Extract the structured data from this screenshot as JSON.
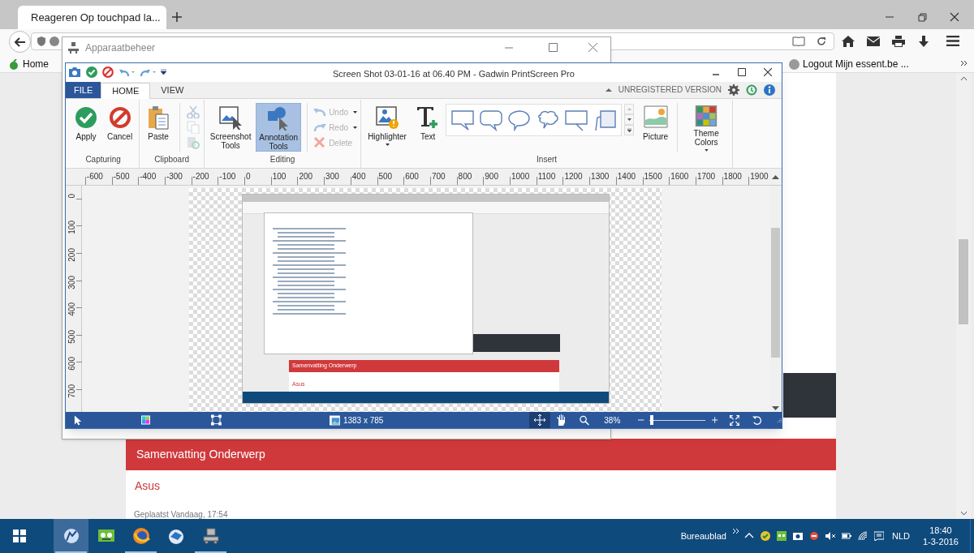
{
  "browser": {
    "tab": {
      "title": "Reageren Op touchpad la..."
    },
    "bookmarks": [
      {
        "label": "Home"
      },
      {
        "label": "Logout Mijn essent.be ..."
      }
    ],
    "page": {
      "card_title": "Samenvatting Onderwerp",
      "card_subtitle": "Asus",
      "posted": "Geplaatst Vandaag, 17:54"
    }
  },
  "device_manager": {
    "title": "Apparaatbeheer"
  },
  "editor": {
    "title": "Screen Shot 03-01-16 at 06.40 PM - Gadwin PrintScreen Pro",
    "ribbon_tabs": [
      {
        "label": "FILE",
        "kind": "file",
        "selected": false
      },
      {
        "label": "HOME",
        "kind": "tab",
        "selected": true
      },
      {
        "label": "VIEW",
        "kind": "tab",
        "selected": false
      }
    ],
    "registration": "UNREGISTERED VERSION",
    "groups": [
      {
        "label": "Capturing",
        "items": [
          {
            "kind": "large",
            "label": "Apply",
            "selected": false,
            "dropdown": false
          },
          {
            "kind": "large",
            "label": "Cancel",
            "selected": false,
            "dropdown": false
          }
        ]
      },
      {
        "label": "Clipboard",
        "items": [
          {
            "kind": "large",
            "label": "Paste",
            "selected": false,
            "dropdown": false
          },
          {
            "kind": "separator"
          },
          {
            "kind": "icon",
            "disabled": true
          },
          {
            "kind": "icon",
            "disabled": true
          },
          {
            "kind": "icon",
            "disabled": true
          }
        ]
      },
      {
        "label": "Editing",
        "items": [
          {
            "kind": "large",
            "label": "Screenshot Tools",
            "selected": false,
            "dropdown": false
          },
          {
            "kind": "large",
            "label": "Annotation Tools",
            "selected": true,
            "dropdown": false
          },
          {
            "kind": "separator"
          },
          {
            "kind": "small",
            "label": "Undo",
            "disabled": true,
            "dropdown": true
          },
          {
            "kind": "small",
            "label": "Redo",
            "disabled": true,
            "dropdown": true
          },
          {
            "kind": "small",
            "label": "Delete",
            "disabled": true,
            "dropdown": false
          }
        ]
      },
      {
        "label": "Insert",
        "items": [
          {
            "kind": "large",
            "label": "Highlighter",
            "selected": false,
            "dropdown": true
          },
          {
            "kind": "large",
            "label": "Text",
            "selected": false,
            "dropdown": false
          },
          {
            "kind": "gallery"
          },
          {
            "kind": "large",
            "label": "Picture",
            "selected": false,
            "dropdown": false
          },
          {
            "kind": "separator"
          },
          {
            "kind": "large",
            "label": "Theme Colors",
            "selected": false,
            "dropdown": true
          }
        ]
      }
    ],
    "ruler": {
      "horizontal": [
        "-600",
        "-500",
        "-400",
        "-300",
        "-200",
        "-100",
        "0",
        "100",
        "200",
        "300",
        "400",
        "500",
        "600",
        "700",
        "800",
        "900",
        "1000",
        "1100",
        "1200",
        "1300",
        "1400",
        "1500",
        "1600",
        "1700",
        "1800",
        "1900"
      ],
      "vertical": [
        "0",
        "100",
        "200",
        "300",
        "400",
        "500",
        "600",
        "700"
      ]
    },
    "preview": {
      "card_title": "Samenvatting Onderwerp",
      "card_subtitle": "Asus"
    },
    "status": {
      "dimensions": "1383 x 785",
      "pan_tools": [
        {
          "selected": true
        },
        {
          "selected": false
        }
      ],
      "zoom": "38%",
      "zoom_slider": {
        "level": 0.02
      }
    }
  },
  "taskbar": {
    "apps": [
      {
        "selected": true,
        "running": true
      },
      {
        "selected": false,
        "running": false
      },
      {
        "selected": false,
        "running": true
      },
      {
        "selected": false,
        "running": false
      },
      {
        "selected": false,
        "running": true
      }
    ],
    "desktop_label": "Bureaublad",
    "language": "NLD",
    "time": "18:40",
    "date": "1-3-2016"
  }
}
